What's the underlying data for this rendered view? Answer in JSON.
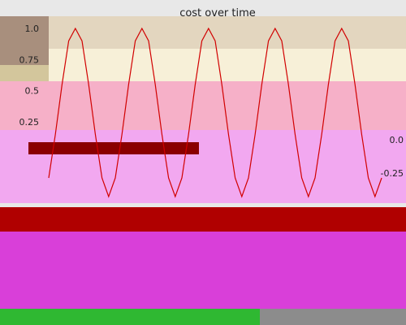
{
  "chart_data": {
    "type": "line",
    "title": "cost over time",
    "xlabel": "",
    "ylabel": "",
    "grid": false,
    "colors": {
      "line": "#d10000",
      "band_top": "#e3d6bf",
      "band_mid": "#f7f0d8",
      "band_pink": "#f6b0c8",
      "band_magenta": "#f2a8f0",
      "band_dark": "#b00000",
      "left_strip": "#a88f7d",
      "left_strip_2": "#e89bb5",
      "bottom_magenta": "#d93fd9",
      "bottom_green": "#2fb832"
    },
    "left_axis": {
      "ylim": [
        0.25,
        1.0
      ],
      "ticks": [
        "1.0",
        "0.75",
        "0.5",
        "0.25"
      ]
    },
    "right_axis": {
      "ylim": [
        -0.25,
        0.0
      ],
      "ticks": [
        "0.0",
        "-0.25"
      ]
    },
    "xlim": [
      0,
      5
    ],
    "series": [
      {
        "x": [
          0.0,
          0.1,
          0.2,
          0.3,
          0.4,
          0.5,
          0.6,
          0.7,
          0.8,
          0.9,
          1.0,
          1.1,
          1.2,
          1.3,
          1.4,
          1.5,
          1.6,
          1.7,
          1.8,
          1.9,
          2.0,
          2.1,
          2.2,
          2.3,
          2.4,
          2.5,
          2.6,
          2.7,
          2.8,
          2.9,
          3.0,
          3.1,
          3.2,
          3.3,
          3.4,
          3.5,
          3.6,
          3.7,
          3.8,
          3.9,
          4.0,
          4.1,
          4.2,
          4.3,
          4.4,
          4.5,
          4.6,
          4.7,
          4.8,
          4.9,
          5.0
        ],
        "y": [
          -0.2,
          0.15,
          0.55,
          0.9,
          1.0,
          0.9,
          0.55,
          0.15,
          -0.2,
          -0.35,
          -0.2,
          0.15,
          0.55,
          0.9,
          1.0,
          0.9,
          0.55,
          0.15,
          -0.2,
          -0.35,
          -0.2,
          0.15,
          0.55,
          0.9,
          1.0,
          0.9,
          0.55,
          0.15,
          -0.2,
          -0.35,
          -0.2,
          0.15,
          0.55,
          0.9,
          1.0,
          0.9,
          0.55,
          0.15,
          -0.2,
          -0.35,
          -0.2,
          0.15,
          0.55,
          0.9,
          1.0,
          0.9,
          0.55,
          0.15,
          -0.2,
          -0.35,
          -0.2
        ]
      }
    ]
  }
}
